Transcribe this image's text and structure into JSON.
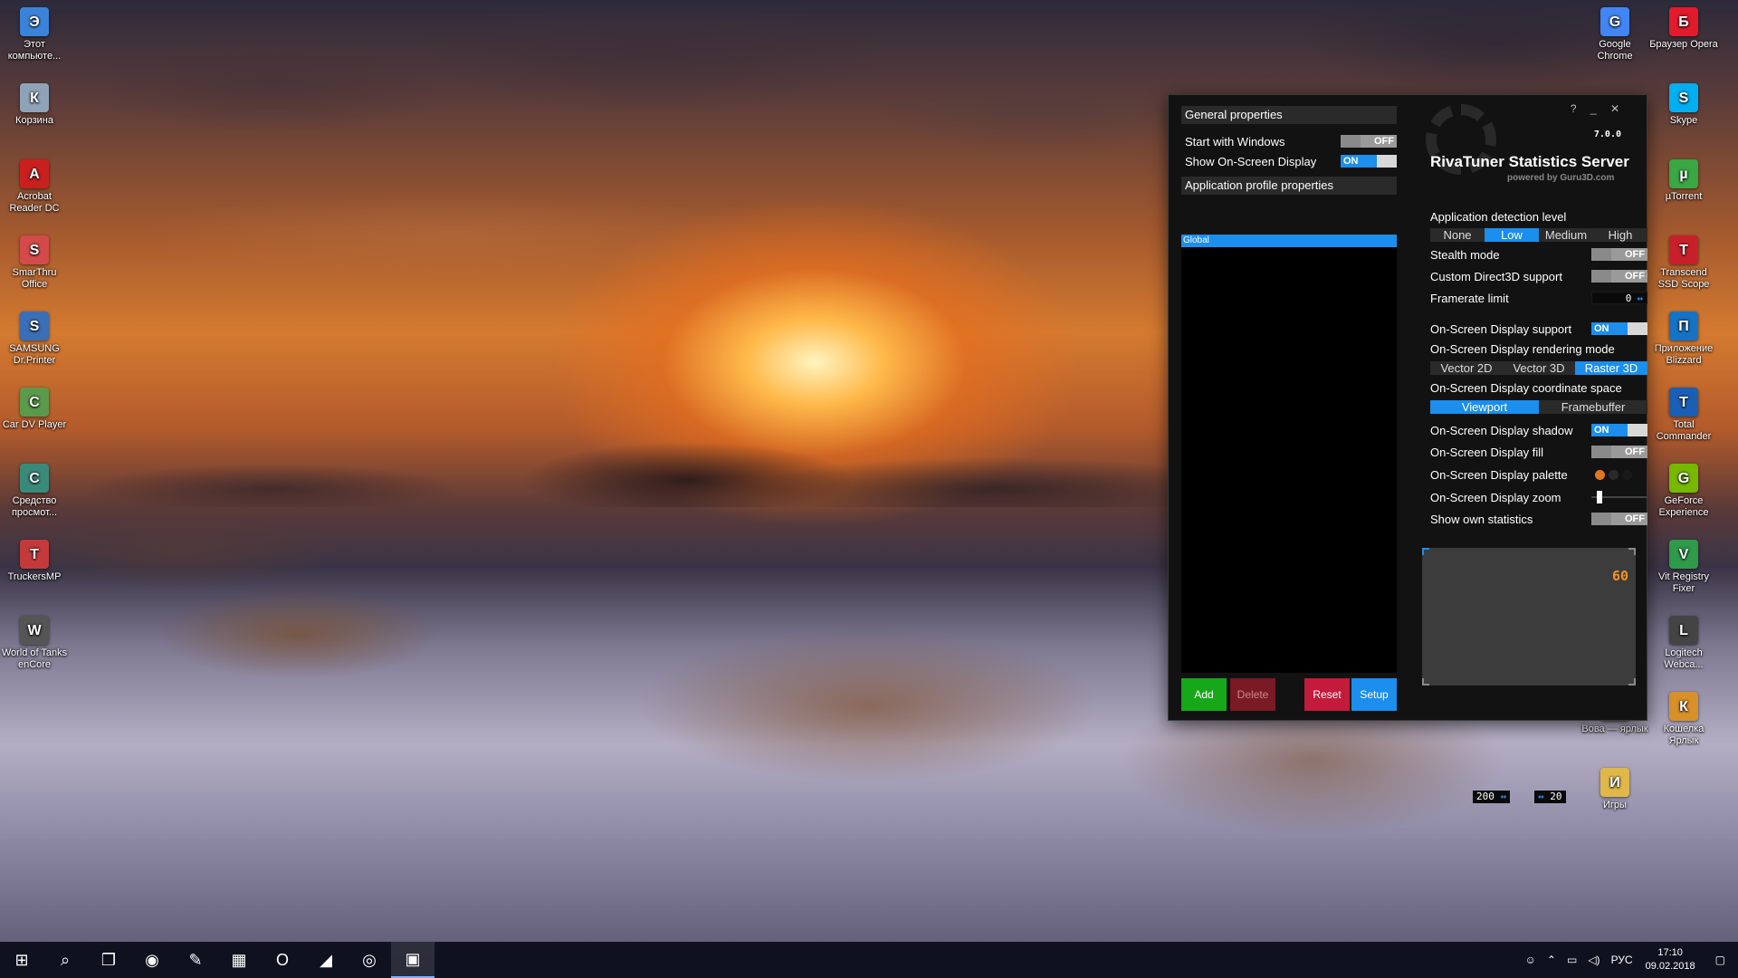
{
  "desktop_left": [
    {
      "label": "Этот компьюте...",
      "icon": "computer-icon",
      "color": "#3b83d8"
    },
    {
      "label": "Корзина",
      "icon": "recycle-bin-icon",
      "color": "#8fa3b8"
    },
    {
      "label": "Acrobat Reader DC",
      "icon": "acrobat-icon",
      "color": "#c8201e"
    },
    {
      "label": "SmarThru Office",
      "icon": "smarthru-icon",
      "color": "#d34a4a"
    },
    {
      "label": "SAMSUNG Dr.Printer",
      "icon": "printer-icon",
      "color": "#3a6fb8"
    },
    {
      "label": "Car DV Player",
      "icon": "dv-player-icon",
      "color": "#5a9a4a"
    },
    {
      "label": "Средство просмот...",
      "icon": "viewer-icon",
      "color": "#3a8a7a"
    },
    {
      "label": "TruckersMP",
      "icon": "truck-icon",
      "color": "#c43a3a"
    },
    {
      "label": "World of Tanks enCore",
      "icon": "tanks-icon",
      "color": "#555555"
    }
  ],
  "desktop_right": [
    {
      "label": "Google Chrome",
      "icon": "chrome-icon",
      "color": "#4285f4"
    },
    {
      "label": "Браузер Opera",
      "icon": "opera-icon",
      "color": "#e11a2c"
    },
    {
      "label": "Skype",
      "icon": "skype-icon",
      "color": "#00aff0"
    },
    {
      "label": "µTorrent",
      "icon": "utorrent-icon",
      "color": "#3aa644"
    },
    {
      "label": "Transcend SSD Scope",
      "icon": "ssd-scope-icon",
      "color": "#c8202a"
    },
    {
      "label": "Приложение Blizzard",
      "icon": "blizzard-icon",
      "color": "#1573c5"
    },
    {
      "label": "Total Commander",
      "icon": "total-commander-icon",
      "color": "#1a5fb4"
    },
    {
      "label": "GeForce Experience",
      "icon": "geforce-icon",
      "color": "#76b900"
    },
    {
      "label": "Vit Registry Fixer",
      "icon": "registry-fixer-icon",
      "color": "#2e9a4a"
    },
    {
      "label": "Logitech Webca...",
      "icon": "webcam-icon",
      "color": "#444444"
    },
    {
      "label": "Кошелка Ярлык",
      "icon": "kosheлка-icon",
      "color": "#d8902a"
    },
    {
      "label": "Вова — ярлык",
      "icon": "shortcut-icon",
      "color": "#666666"
    },
    {
      "label": "Игры",
      "icon": "games-folder-icon",
      "color": "#e0b84a"
    }
  ],
  "rtss": {
    "general_header": "General properties",
    "start_with_windows": {
      "label": "Start with Windows",
      "state": "OFF"
    },
    "show_osd": {
      "label": "Show On-Screen Display",
      "state": "ON"
    },
    "app_profile_header": "Application profile properties",
    "profile_selected": "Global",
    "buttons": {
      "add": "Add",
      "delete": "Delete",
      "reset": "Reset",
      "setup": "Setup"
    },
    "button_colors": {
      "add": "#17a81a",
      "delete": "#7a1a24",
      "reset": "#c41a3c",
      "setup": "#1b8eee"
    },
    "titlebar": "? _ ✕",
    "version": "7.0.0",
    "title": "RivaTuner Statistics Server",
    "powered_by": "powered by Guru3D.com",
    "detection_label": "Application detection level",
    "detection_levels": [
      "None",
      "Low",
      "Medium",
      "High"
    ],
    "detection_selected": "Low",
    "stealth": {
      "label": "Stealth mode",
      "state": "OFF"
    },
    "custom_d3d": {
      "label": "Custom Direct3D support",
      "state": "OFF"
    },
    "framerate": {
      "label": "Framerate limit",
      "value": "0"
    },
    "osd_support": {
      "label": "On-Screen Display support",
      "state": "ON"
    },
    "render_mode_label": "On-Screen Display rendering mode",
    "render_modes": [
      "Vector 2D",
      "Vector 3D",
      "Raster 3D"
    ],
    "render_selected": "Raster 3D",
    "coord_label": "On-Screen Display coordinate space",
    "coord_modes": [
      "Viewport",
      "Framebuffer"
    ],
    "coord_selected": "Viewport",
    "shadow": {
      "label": "On-Screen Display shadow",
      "state": "ON"
    },
    "fill": {
      "label": "On-Screen Display fill",
      "state": "OFF"
    },
    "palette": {
      "label": "On-Screen Display palette",
      "colors": [
        "#e07820",
        "#2a2a2a",
        "#1a1a1a"
      ]
    },
    "zoom": {
      "label": "On-Screen Display zoom",
      "level": 0.1
    },
    "own_stats": {
      "label": "Show own statistics",
      "state": "OFF"
    },
    "preview_fps": "60",
    "pos_x": "200",
    "pos_y": "20"
  },
  "taskbar": {
    "apps": [
      "start-icon",
      "search-icon",
      "task-view-icon",
      "chrome-icon",
      "paint-icon",
      "calculator-icon",
      "opera-icon",
      "msi-afterburner-icon",
      "steam-icon",
      "rtss-icon"
    ],
    "lang": "РУС",
    "time": "17:10",
    "date": "09.02.2018"
  },
  "accent": "#1b8eee"
}
